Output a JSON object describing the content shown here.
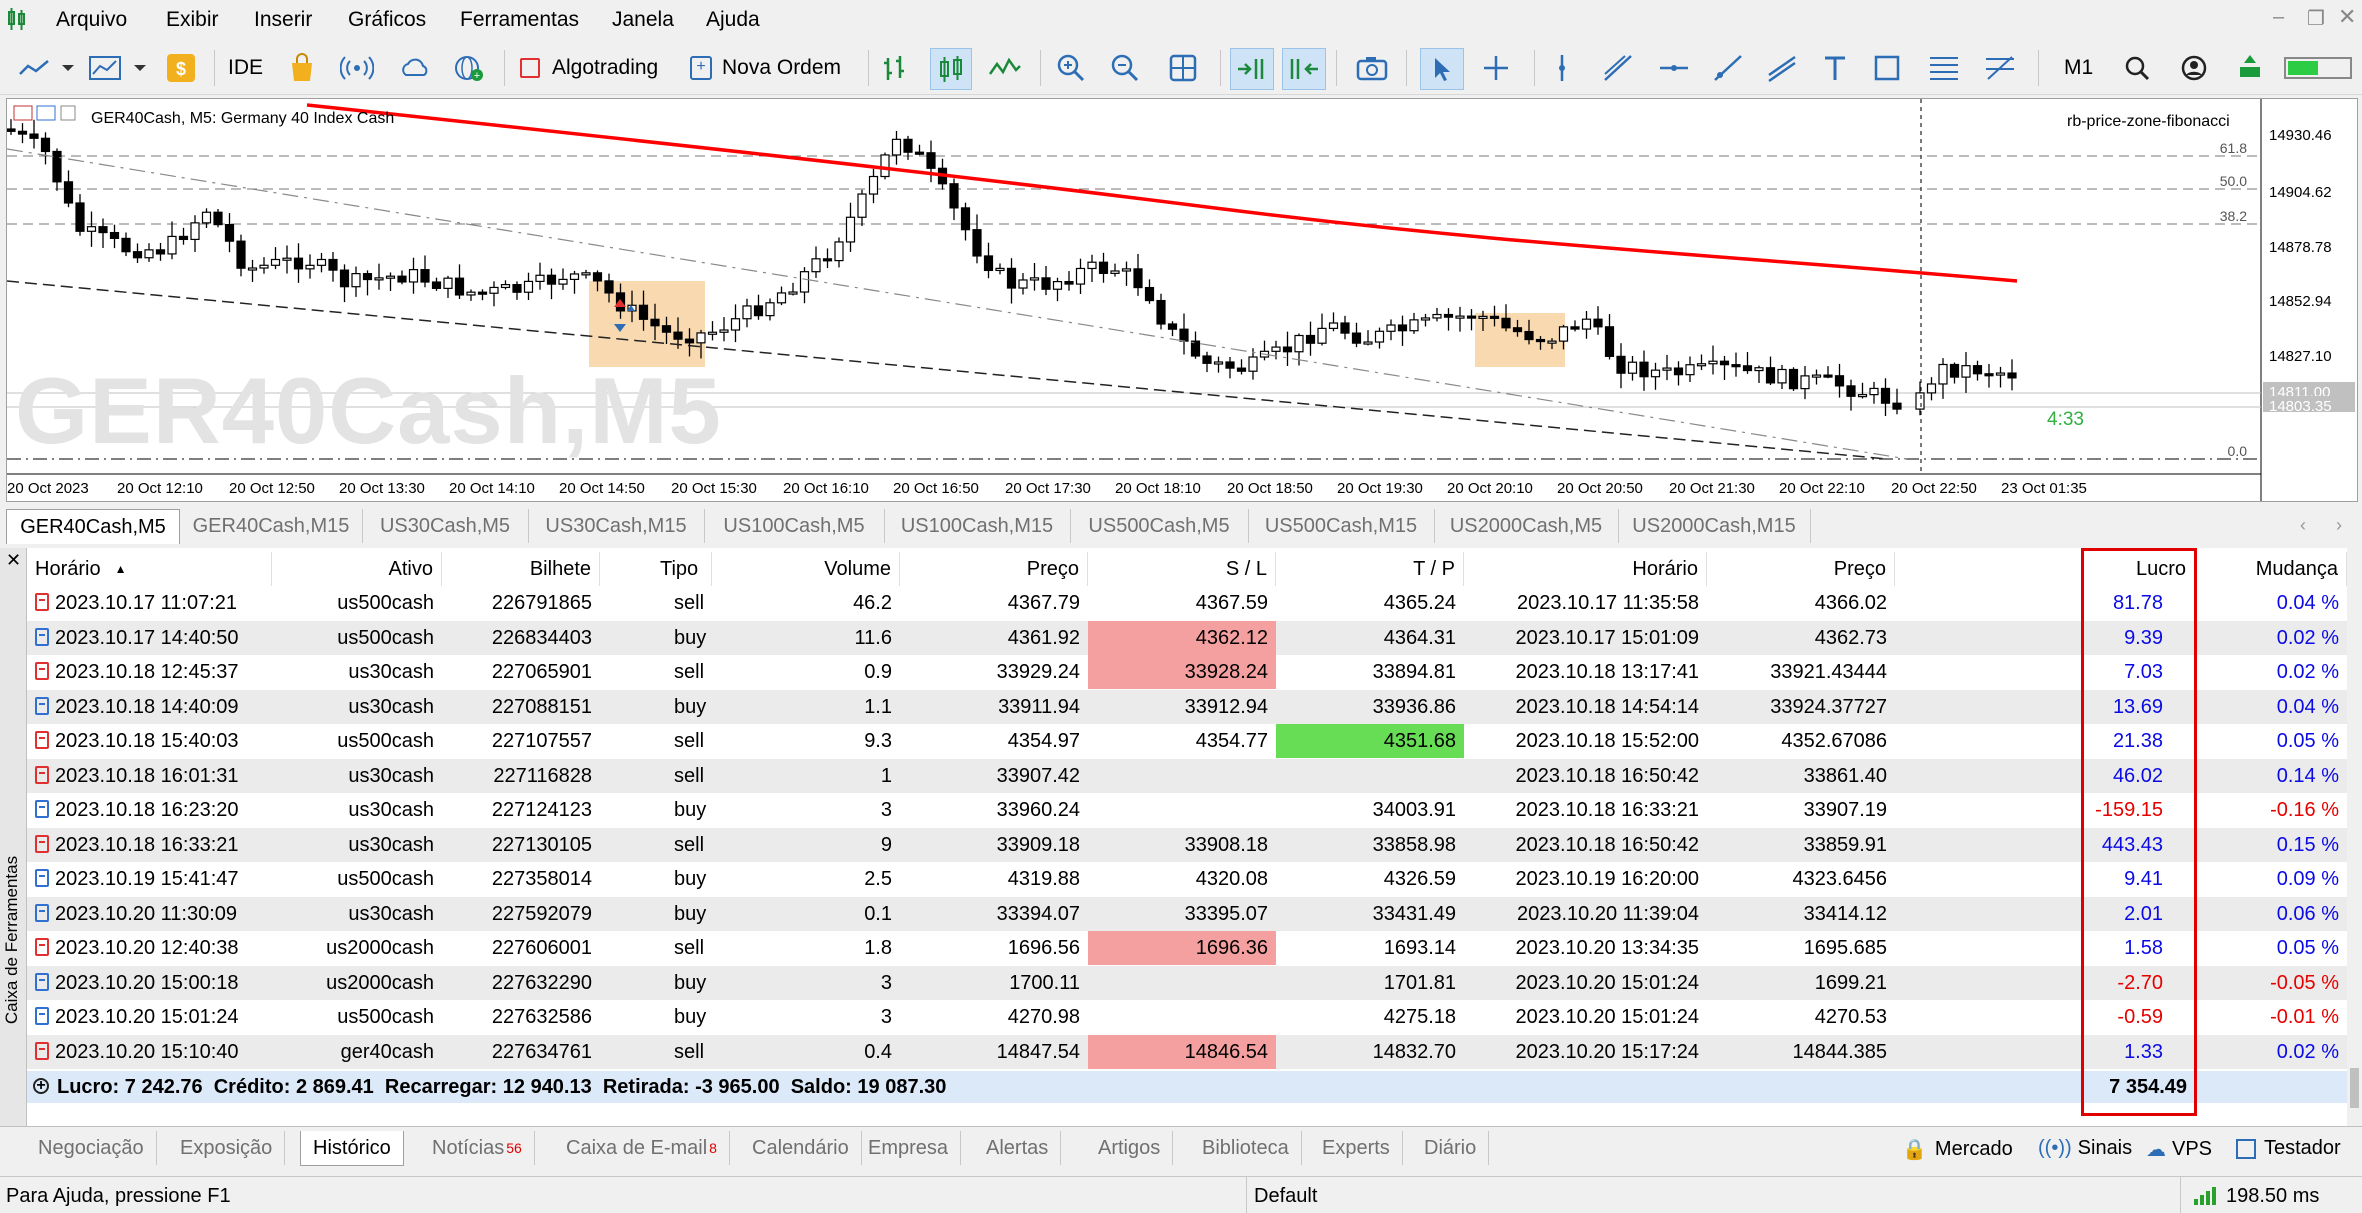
{
  "menu": [
    "Arquivo",
    "Exibir",
    "Inserir",
    "Gráficos",
    "Ferramentas",
    "Janela",
    "Ajuda"
  ],
  "toolbar": {
    "ide": "IDE",
    "algotrading": "Algotrading",
    "nova_ordem": "Nova Ordem",
    "timeframe": "M1"
  },
  "chart": {
    "header": "GER40Cash, M5:  Germany 40 Index Cash",
    "watermark": "GER40Cash,M5",
    "indicator": "rb-price-zone-fibonacci",
    "countdown": "4:33",
    "price_labels": [
      "14930.46",
      "14904.62",
      "14878.78",
      "14852.94",
      "14827.10",
      "14811.00",
      "14803.35"
    ],
    "fib_labels": [
      "61.8",
      "50.0",
      "38.2",
      "0.0"
    ],
    "time_labels": [
      "20 Oct 2023",
      "20 Oct 12:10",
      "20 Oct 12:50",
      "20 Oct 13:30",
      "20 Oct 14:10",
      "20 Oct 14:50",
      "20 Oct 15:30",
      "20 Oct 16:10",
      "20 Oct 16:50",
      "20 Oct 17:30",
      "20 Oct 18:10",
      "20 Oct 18:50",
      "20 Oct 19:30",
      "20 Oct 20:10",
      "20 Oct 20:50",
      "20 Oct 21:30",
      "20 Oct 22:10",
      "20 Oct 22:50",
      "23 Oct 01:35"
    ],
    "colors": {
      "ma": "#ff0000",
      "zone": "#f8d9b0",
      "watermark": "#e0e0e0",
      "bid": "#c0c0c0"
    }
  },
  "chart_tabs": [
    "GER40Cash,M5",
    "GER40Cash,M15",
    "US30Cash,M5",
    "US30Cash,M15",
    "US100Cash,M5",
    "US100Cash,M15",
    "US500Cash,M5",
    "US500Cash,M15",
    "US2000Cash,M5",
    "US2000Cash,M15"
  ],
  "table": {
    "headers": [
      "Horário",
      "Ativo",
      "Bilhete",
      "Tipo",
      "Volume",
      "Preço",
      "S / L",
      "T / P",
      "Horário",
      "Preço",
      "Lucro",
      "Mudança"
    ],
    "rows": [
      {
        "type_icon": "s",
        "time": "2023.10.17 11:07:21",
        "symbol": "us500cash",
        "ticket": "226791865",
        "kind": "sell",
        "volume": "46.2",
        "price": "4367.79",
        "sl": "4367.59",
        "tp": "4365.24",
        "close_time": "2023.10.17 11:35:58",
        "close_price": "4366.02",
        "profit": "81.78",
        "change": "0.04 %",
        "sl_hl": "",
        "tp_hl": "",
        "neg": false
      },
      {
        "type_icon": "b",
        "time": "2023.10.17 14:40:50",
        "symbol": "us500cash",
        "ticket": "226834403",
        "kind": "buy",
        "volume": "11.6",
        "price": "4361.92",
        "sl": "4362.12",
        "tp": "4364.31",
        "close_time": "2023.10.17 15:01:09",
        "close_price": "4362.73",
        "profit": "9.39",
        "change": "0.02 %",
        "sl_hl": "red",
        "tp_hl": "",
        "neg": false
      },
      {
        "type_icon": "s",
        "time": "2023.10.18 12:45:37",
        "symbol": "us30cash",
        "ticket": "227065901",
        "kind": "sell",
        "volume": "0.9",
        "price": "33929.24",
        "sl": "33928.24",
        "tp": "33894.81",
        "close_time": "2023.10.18 13:17:41",
        "close_price": "33921.43444",
        "profit": "7.03",
        "change": "0.02 %",
        "sl_hl": "red",
        "tp_hl": "",
        "neg": false
      },
      {
        "type_icon": "b",
        "time": "2023.10.18 14:40:09",
        "symbol": "us30cash",
        "ticket": "227088151",
        "kind": "buy",
        "volume": "1.1",
        "price": "33911.94",
        "sl": "33912.94",
        "tp": "33936.86",
        "close_time": "2023.10.18 14:54:14",
        "close_price": "33924.37727",
        "profit": "13.69",
        "change": "0.04 %",
        "sl_hl": "",
        "tp_hl": "",
        "neg": false
      },
      {
        "type_icon": "s",
        "time": "2023.10.18 15:40:03",
        "symbol": "us500cash",
        "ticket": "227107557",
        "kind": "sell",
        "volume": "9.3",
        "price": "4354.97",
        "sl": "4354.77",
        "tp": "4351.68",
        "close_time": "2023.10.18 15:52:00",
        "close_price": "4352.67086",
        "profit": "21.38",
        "change": "0.05 %",
        "sl_hl": "",
        "tp_hl": "green",
        "neg": false
      },
      {
        "type_icon": "s",
        "time": "2023.10.18 16:01:31",
        "symbol": "us30cash",
        "ticket": "227116828",
        "kind": "sell",
        "volume": "1",
        "price": "33907.42",
        "sl": "",
        "tp": "",
        "close_time": "2023.10.18 16:50:42",
        "close_price": "33861.40",
        "profit": "46.02",
        "change": "0.14 %",
        "sl_hl": "",
        "tp_hl": "",
        "neg": false
      },
      {
        "type_icon": "b",
        "time": "2023.10.18 16:23:20",
        "symbol": "us30cash",
        "ticket": "227124123",
        "kind": "buy",
        "volume": "3",
        "price": "33960.24",
        "sl": "",
        "tp": "34003.91",
        "close_time": "2023.10.18 16:33:21",
        "close_price": "33907.19",
        "profit": "-159.15",
        "change": "-0.16 %",
        "sl_hl": "",
        "tp_hl": "",
        "neg": true
      },
      {
        "type_icon": "s",
        "time": "2023.10.18 16:33:21",
        "symbol": "us30cash",
        "ticket": "227130105",
        "kind": "sell",
        "volume": "9",
        "price": "33909.18",
        "sl": "33908.18",
        "tp": "33858.98",
        "close_time": "2023.10.18 16:50:42",
        "close_price": "33859.91",
        "profit": "443.43",
        "change": "0.15 %",
        "sl_hl": "",
        "tp_hl": "",
        "neg": false
      },
      {
        "type_icon": "b",
        "time": "2023.10.19 15:41:47",
        "symbol": "us500cash",
        "ticket": "227358014",
        "kind": "buy",
        "volume": "2.5",
        "price": "4319.88",
        "sl": "4320.08",
        "tp": "4326.59",
        "close_time": "2023.10.19 16:20:00",
        "close_price": "4323.6456",
        "profit": "9.41",
        "change": "0.09 %",
        "sl_hl": "",
        "tp_hl": "",
        "neg": false
      },
      {
        "type_icon": "b",
        "time": "2023.10.20 11:30:09",
        "symbol": "us30cash",
        "ticket": "227592079",
        "kind": "buy",
        "volume": "0.1",
        "price": "33394.07",
        "sl": "33395.07",
        "tp": "33431.49",
        "close_time": "2023.10.20 11:39:04",
        "close_price": "33414.12",
        "profit": "2.01",
        "change": "0.06 %",
        "sl_hl": "",
        "tp_hl": "",
        "neg": false
      },
      {
        "type_icon": "s",
        "time": "2023.10.20 12:40:38",
        "symbol": "us2000cash",
        "ticket": "227606001",
        "kind": "sell",
        "volume": "1.8",
        "price": "1696.56",
        "sl": "1696.36",
        "tp": "1693.14",
        "close_time": "2023.10.20 13:34:35",
        "close_price": "1695.685",
        "profit": "1.58",
        "change": "0.05 %",
        "sl_hl": "red",
        "tp_hl": "",
        "neg": false
      },
      {
        "type_icon": "b",
        "time": "2023.10.20 15:00:18",
        "symbol": "us2000cash",
        "ticket": "227632290",
        "kind": "buy",
        "volume": "3",
        "price": "1700.11",
        "sl": "",
        "tp": "1701.81",
        "close_time": "2023.10.20 15:01:24",
        "close_price": "1699.21",
        "profit": "-2.70",
        "change": "-0.05 %",
        "sl_hl": "",
        "tp_hl": "",
        "neg": true
      },
      {
        "type_icon": "b",
        "time": "2023.10.20 15:01:24",
        "symbol": "us500cash",
        "ticket": "227632586",
        "kind": "buy",
        "volume": "3",
        "price": "4270.98",
        "sl": "",
        "tp": "4275.18",
        "close_time": "2023.10.20 15:01:24",
        "close_price": "4270.53",
        "profit": "-0.59",
        "change": "-0.01 %",
        "sl_hl": "",
        "tp_hl": "",
        "neg": true
      },
      {
        "type_icon": "s",
        "time": "2023.10.20 15:10:40",
        "symbol": "ger40cash",
        "ticket": "227634761",
        "kind": "sell",
        "volume": "0.4",
        "price": "14847.54",
        "sl": "14846.54",
        "tp": "14832.70",
        "close_time": "2023.10.20 15:17:24",
        "close_price": "14844.385",
        "profit": "1.33",
        "change": "0.02 %",
        "sl_hl": "red",
        "tp_hl": "",
        "neg": false
      }
    ],
    "summary": "Lucro: 7 242.76  Crédito: 2 869.41  Recarregar: 12 940.13  Retirada: -3 965.00  Saldo: 19 087.30",
    "summary_profit": "7 354.49"
  },
  "toolbox_label": "Caixa de Ferramentas",
  "bottom_tabs": [
    {
      "label": "Negociação",
      "badge": ""
    },
    {
      "label": "Exposição",
      "badge": ""
    },
    {
      "label": "Histórico",
      "badge": ""
    },
    {
      "label": "Notícias",
      "badge": "56"
    },
    {
      "label": "Caixa de E-mail",
      "badge": "8"
    },
    {
      "label": "Calendário",
      "badge": ""
    },
    {
      "label": "Empresa",
      "badge": ""
    },
    {
      "label": "Alertas",
      "badge": ""
    },
    {
      "label": "Artigos",
      "badge": ""
    },
    {
      "label": "Biblioteca",
      "badge": ""
    },
    {
      "label": "Experts",
      "badge": ""
    },
    {
      "label": "Diário",
      "badge": ""
    }
  ],
  "bottom_right": {
    "mercado": "Mercado",
    "sinais": "Sinais",
    "vps": "VPS",
    "testador": "Testador"
  },
  "status": {
    "help": "Para Ajuda, pressione F1",
    "profile": "Default",
    "ping": "198.50 ms"
  }
}
